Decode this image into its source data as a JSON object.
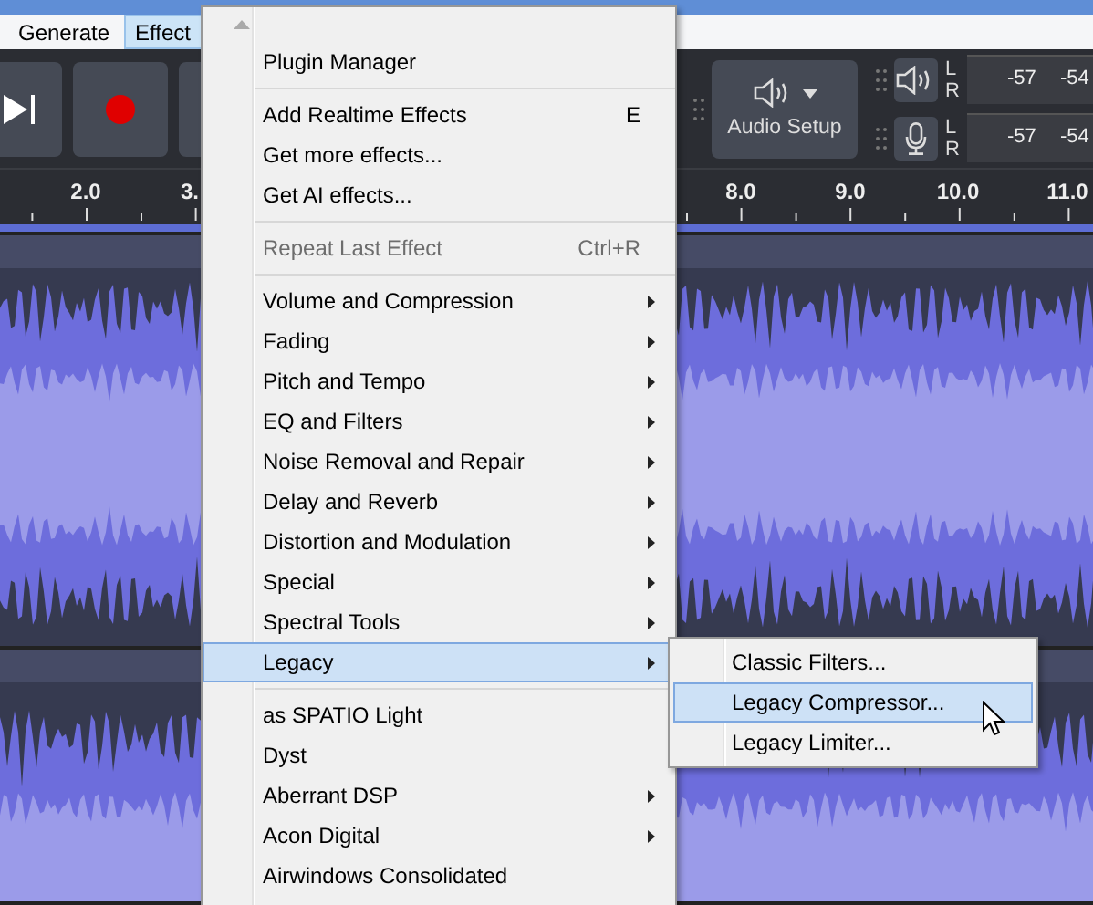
{
  "menubar": [
    {
      "label": "Generate",
      "selected": false
    },
    {
      "label": "Effect",
      "selected": true
    }
  ],
  "toolbar": {
    "audio_setup": "Audio Setup",
    "meters": [
      {
        "kind": "playback",
        "channels": [
          "L",
          "R"
        ],
        "scale": [
          "-57",
          "-54"
        ]
      },
      {
        "kind": "recording",
        "channels": [
          "L",
          "R"
        ],
        "scale": [
          "-57",
          "-54"
        ]
      }
    ]
  },
  "ruler": {
    "labels": [
      "2.0",
      "3.",
      "8.0",
      "9.0",
      "10.0",
      "11.0"
    ]
  },
  "effect_menu": {
    "items": [
      {
        "kind": "item",
        "label": "Plugin Manager",
        "submenu": false,
        "disabled": false,
        "selected": false
      },
      {
        "kind": "separator"
      },
      {
        "kind": "item",
        "label": "Add Realtime Effects",
        "shortcut": "E",
        "submenu": false,
        "disabled": false,
        "selected": false
      },
      {
        "kind": "item",
        "label": "Get more effects...",
        "submenu": false,
        "disabled": false,
        "selected": false
      },
      {
        "kind": "item",
        "label": "Get AI effects...",
        "submenu": false,
        "disabled": false,
        "selected": false
      },
      {
        "kind": "separator"
      },
      {
        "kind": "item",
        "label": "Repeat Last Effect",
        "shortcut": "Ctrl+R",
        "submenu": false,
        "disabled": true,
        "selected": false
      },
      {
        "kind": "separator"
      },
      {
        "kind": "item",
        "label": "Volume and Compression",
        "submenu": true,
        "disabled": false,
        "selected": false
      },
      {
        "kind": "item",
        "label": "Fading",
        "submenu": true,
        "disabled": false,
        "selected": false
      },
      {
        "kind": "item",
        "label": "Pitch and Tempo",
        "submenu": true,
        "disabled": false,
        "selected": false
      },
      {
        "kind": "item",
        "label": "EQ and Filters",
        "submenu": true,
        "disabled": false,
        "selected": false
      },
      {
        "kind": "item",
        "label": "Noise Removal and Repair",
        "submenu": true,
        "disabled": false,
        "selected": false
      },
      {
        "kind": "item",
        "label": "Delay and Reverb",
        "submenu": true,
        "disabled": false,
        "selected": false
      },
      {
        "kind": "item",
        "label": "Distortion and Modulation",
        "submenu": true,
        "disabled": false,
        "selected": false
      },
      {
        "kind": "item",
        "label": "Special",
        "submenu": true,
        "disabled": false,
        "selected": false
      },
      {
        "kind": "item",
        "label": "Spectral Tools",
        "submenu": true,
        "disabled": false,
        "selected": false
      },
      {
        "kind": "item",
        "label": "Legacy",
        "submenu": true,
        "disabled": false,
        "selected": true
      },
      {
        "kind": "separator"
      },
      {
        "kind": "item",
        "label": "as SPATIO Light",
        "submenu": false,
        "disabled": false,
        "selected": false
      },
      {
        "kind": "item",
        "label": "Dyst",
        "submenu": false,
        "disabled": false,
        "selected": false
      },
      {
        "kind": "item",
        "label": "Aberrant DSP",
        "submenu": true,
        "disabled": false,
        "selected": false
      },
      {
        "kind": "item",
        "label": "Acon Digital",
        "submenu": true,
        "disabled": false,
        "selected": false
      },
      {
        "kind": "item",
        "label": "Airwindows Consolidated",
        "submenu": false,
        "disabled": false,
        "selected": false
      }
    ]
  },
  "legacy_submenu": {
    "items": [
      {
        "label": "Classic Filters...",
        "selected": false
      },
      {
        "label": "Legacy Compressor...",
        "selected": true
      },
      {
        "label": "Legacy Limiter...",
        "selected": false
      }
    ]
  }
}
